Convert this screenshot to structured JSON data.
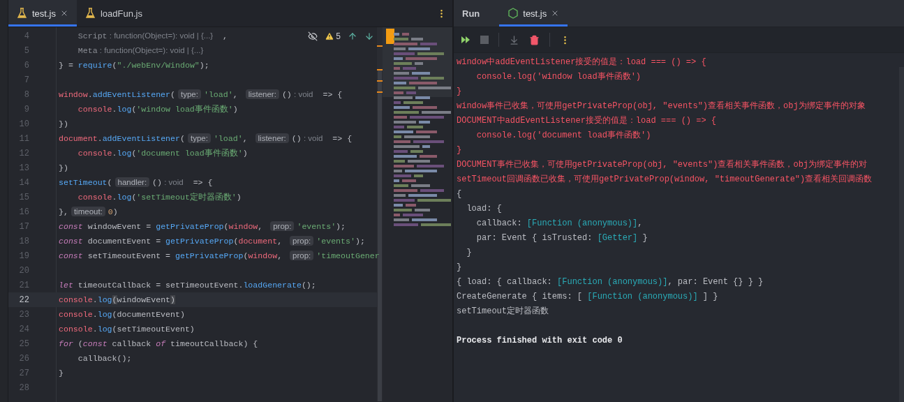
{
  "editor": {
    "tabs": [
      {
        "label": "test.js",
        "selected": true,
        "closable": true
      },
      {
        "label": "loadFun.js",
        "selected": false,
        "closable": false
      }
    ],
    "inspection": {
      "warnings": "5"
    },
    "lines": [
      {
        "number": "4",
        "current": false,
        "tokens": [
          {
            "kind": "dim",
            "text": "    Script"
          },
          {
            "kind": "hint",
            "text": " : function(Object=): void | {...}"
          },
          {
            "kind": "plain",
            "text": "  ,"
          }
        ]
      },
      {
        "number": "5",
        "current": false,
        "tokens": [
          {
            "kind": "dim",
            "text": "    Meta"
          },
          {
            "kind": "hint",
            "text": " : function(Object=): void | {...}"
          }
        ]
      },
      {
        "number": "6",
        "current": false,
        "tokens": [
          {
            "kind": "plain",
            "text": "} = "
          },
          {
            "kind": "fn",
            "text": "require"
          },
          {
            "kind": "plain",
            "text": "("
          },
          {
            "kind": "str",
            "text": "\"./webEnv/Window\""
          },
          {
            "kind": "plain",
            "text": ");"
          }
        ]
      },
      {
        "number": "7",
        "current": false
      },
      {
        "number": "8",
        "current": false,
        "tokens": [
          {
            "kind": "glob",
            "text": "window"
          },
          {
            "kind": "plain",
            "text": "."
          },
          {
            "kind": "fn",
            "text": "addEventListener"
          },
          {
            "kind": "plain",
            "text": "("
          },
          {
            "kind": "chip",
            "text": "type:"
          },
          {
            "kind": "str",
            "text": "'load'"
          },
          {
            "kind": "plain",
            "text": ", "
          },
          {
            "kind": "chip",
            "text": "listener:"
          },
          {
            "kind": "plain",
            "text": "()"
          },
          {
            "kind": "hint",
            "text": " : void"
          },
          {
            "kind": "plain",
            "text": "  => {"
          }
        ]
      },
      {
        "number": "9",
        "current": false,
        "tokens": [
          {
            "kind": "glob",
            "text": "    console"
          },
          {
            "kind": "plain",
            "text": "."
          },
          {
            "kind": "fn",
            "text": "log"
          },
          {
            "kind": "plain",
            "text": "("
          },
          {
            "kind": "str",
            "text": "'window load事件函数'"
          },
          {
            "kind": "plain",
            "text": ")"
          }
        ]
      },
      {
        "number": "10",
        "current": false,
        "tokens": [
          {
            "kind": "plain",
            "text": "})"
          }
        ]
      },
      {
        "number": "11",
        "current": false,
        "tokens": [
          {
            "kind": "glob",
            "text": "document"
          },
          {
            "kind": "plain",
            "text": "."
          },
          {
            "kind": "fn",
            "text": "addEventListener"
          },
          {
            "kind": "plain",
            "text": "("
          },
          {
            "kind": "chip",
            "text": "type:"
          },
          {
            "kind": "str",
            "text": "'load'"
          },
          {
            "kind": "plain",
            "text": ", "
          },
          {
            "kind": "chip",
            "text": "listener:"
          },
          {
            "kind": "plain",
            "text": "()"
          },
          {
            "kind": "hint",
            "text": " : void"
          },
          {
            "kind": "plain",
            "text": "  => {"
          }
        ]
      },
      {
        "number": "12",
        "current": false,
        "tokens": [
          {
            "kind": "glob",
            "text": "    console"
          },
          {
            "kind": "plain",
            "text": "."
          },
          {
            "kind": "fn",
            "text": "log"
          },
          {
            "kind": "plain",
            "text": "("
          },
          {
            "kind": "str",
            "text": "'document load事件函数'"
          },
          {
            "kind": "plain",
            "text": ")"
          }
        ]
      },
      {
        "number": "13",
        "current": false,
        "tokens": [
          {
            "kind": "plain",
            "text": "})"
          }
        ]
      },
      {
        "number": "14",
        "current": false,
        "tokens": [
          {
            "kind": "fn",
            "text": "setTimeout"
          },
          {
            "kind": "plain",
            "text": "("
          },
          {
            "kind": "chip",
            "text": "handler:"
          },
          {
            "kind": "plain",
            "text": "()"
          },
          {
            "kind": "hint",
            "text": " : void"
          },
          {
            "kind": "plain",
            "text": "  => {"
          }
        ]
      },
      {
        "number": "15",
        "current": false,
        "tokens": [
          {
            "kind": "glob",
            "text": "    console"
          },
          {
            "kind": "plain",
            "text": "."
          },
          {
            "kind": "fn",
            "text": "log"
          },
          {
            "kind": "plain",
            "text": "("
          },
          {
            "kind": "str",
            "text": "'setTimeout定时器函数'"
          },
          {
            "kind": "plain",
            "text": ")"
          }
        ]
      },
      {
        "number": "16",
        "current": false,
        "tokens": [
          {
            "kind": "plain",
            "text": "},"
          },
          {
            "kind": "chip",
            "text": "timeout:"
          },
          {
            "kind": "num",
            "text": "0"
          },
          {
            "kind": "plain",
            "text": ")"
          }
        ]
      },
      {
        "number": "17",
        "current": false,
        "tokens": [
          {
            "kind": "kw",
            "text": "const"
          },
          {
            "kind": "plain",
            "text": " windowEvent = "
          },
          {
            "kind": "fn",
            "text": "getPrivateProp"
          },
          {
            "kind": "plain",
            "text": "("
          },
          {
            "kind": "glob",
            "text": "window"
          },
          {
            "kind": "plain",
            "text": ", "
          },
          {
            "kind": "chip",
            "text": "prop:"
          },
          {
            "kind": "str",
            "text": "'events'"
          },
          {
            "kind": "plain",
            "text": ");"
          }
        ]
      },
      {
        "number": "18",
        "current": false,
        "tokens": [
          {
            "kind": "kw",
            "text": "const"
          },
          {
            "kind": "plain",
            "text": " documentEvent = "
          },
          {
            "kind": "fn",
            "text": "getPrivateProp"
          },
          {
            "kind": "plain",
            "text": "("
          },
          {
            "kind": "glob",
            "text": "document"
          },
          {
            "kind": "plain",
            "text": ", "
          },
          {
            "kind": "chip",
            "text": "prop:"
          },
          {
            "kind": "str",
            "text": "'events'"
          },
          {
            "kind": "plain",
            "text": ");"
          }
        ]
      },
      {
        "number": "19",
        "current": false,
        "tokens": [
          {
            "kind": "kw",
            "text": "const"
          },
          {
            "kind": "plain",
            "text": " setTimeoutEvent = "
          },
          {
            "kind": "fn",
            "text": "getPrivateProp"
          },
          {
            "kind": "plain",
            "text": "("
          },
          {
            "kind": "glob",
            "text": "window"
          },
          {
            "kind": "plain",
            "text": ", "
          },
          {
            "kind": "chip",
            "text": "prop:"
          },
          {
            "kind": "str",
            "text": "'timeoutGener"
          }
        ]
      },
      {
        "number": "20",
        "current": false
      },
      {
        "number": "21",
        "current": false,
        "tokens": [
          {
            "kind": "kw",
            "text": "let"
          },
          {
            "kind": "plain",
            "text": " timeoutCallback = setTimeoutEvent."
          },
          {
            "kind": "fn",
            "text": "loadGenerate"
          },
          {
            "kind": "plain",
            "text": "();"
          }
        ]
      },
      {
        "number": "22",
        "current": true,
        "tokens": [
          {
            "kind": "glob",
            "text": "console"
          },
          {
            "kind": "plain",
            "text": "."
          },
          {
            "kind": "fn",
            "text": "log"
          },
          {
            "kind": "bracket",
            "text": "("
          },
          {
            "kind": "plain",
            "text": "windowEvent"
          },
          {
            "kind": "bracket",
            "text": ")"
          }
        ]
      },
      {
        "number": "23",
        "current": false,
        "tokens": [
          {
            "kind": "glob",
            "text": "console"
          },
          {
            "kind": "plain",
            "text": "."
          },
          {
            "kind": "fn",
            "text": "log"
          },
          {
            "kind": "plain",
            "text": "(documentEvent)"
          }
        ]
      },
      {
        "number": "24",
        "current": false,
        "tokens": [
          {
            "kind": "glob",
            "text": "console"
          },
          {
            "kind": "plain",
            "text": "."
          },
          {
            "kind": "fn",
            "text": "log"
          },
          {
            "kind": "plain",
            "text": "(setTimeoutEvent)"
          }
        ]
      },
      {
        "number": "25",
        "current": false,
        "tokens": [
          {
            "kind": "kw",
            "text": "for"
          },
          {
            "kind": "plain",
            "text": " ("
          },
          {
            "kind": "kw",
            "text": "const"
          },
          {
            "kind": "plain",
            "text": " callback "
          },
          {
            "kind": "kw",
            "text": "of"
          },
          {
            "kind": "plain",
            "text": " timeoutCallback) {"
          }
        ]
      },
      {
        "number": "26",
        "current": false,
        "tokens": [
          {
            "kind": "plain",
            "text": "    callback();"
          }
        ]
      },
      {
        "number": "27",
        "current": false,
        "tokens": [
          {
            "kind": "plain",
            "text": "}"
          }
        ]
      },
      {
        "number": "28",
        "current": false
      }
    ]
  },
  "run": {
    "title": "Run",
    "tabs": [
      {
        "label": "test.js",
        "selected": true,
        "closable": true
      }
    ],
    "output": [
      {
        "tokens": [
          {
            "kind": "err",
            "text": "window中addEventListener接受的值是：load === () => {"
          }
        ]
      },
      {
        "tokens": [
          {
            "kind": "err",
            "text": "    console.log('window load事件函数')"
          }
        ]
      },
      {
        "tokens": [
          {
            "kind": "err",
            "text": "}"
          }
        ]
      },
      {
        "tokens": [
          {
            "kind": "err",
            "text": "window事件已收集，可使用getPrivateProp(obj, \"events\")查看相关事件函数，obj为绑定事件的对象"
          }
        ]
      },
      {
        "tokens": [
          {
            "kind": "err",
            "text": "DOCUMENT中addEventListener接受的值是：load === () => {"
          }
        ]
      },
      {
        "tokens": [
          {
            "kind": "err",
            "text": "    console.log('document load事件函数')"
          }
        ]
      },
      {
        "tokens": [
          {
            "kind": "err",
            "text": "}"
          }
        ]
      },
      {
        "tokens": [
          {
            "kind": "err",
            "text": "DOCUMENT事件已收集，可使用getPrivateProp(obj, \"events\")查看相关事件函数，obj为绑定事件的对"
          }
        ]
      },
      {
        "tokens": [
          {
            "kind": "err",
            "text": "setTimeout回调函数已收集，可使用getPrivateProp(window, \"timeoutGenerate\")查看相关回调函数"
          }
        ]
      },
      {
        "tokens": [
          {
            "kind": "out",
            "text": "{"
          }
        ]
      },
      {
        "tokens": [
          {
            "kind": "out",
            "text": "  load: {"
          }
        ]
      },
      {
        "tokens": [
          {
            "kind": "out",
            "text": "    callback: "
          },
          {
            "kind": "link",
            "text": "[Function (anonymous)]"
          },
          {
            "kind": "out",
            "text": ","
          }
        ]
      },
      {
        "tokens": [
          {
            "kind": "out",
            "text": "    par: Event { isTrusted: "
          },
          {
            "kind": "link",
            "text": "[Getter]"
          },
          {
            "kind": "out",
            "text": " }"
          }
        ]
      },
      {
        "tokens": [
          {
            "kind": "out",
            "text": "  }"
          }
        ]
      },
      {
        "tokens": [
          {
            "kind": "out",
            "text": "}"
          }
        ]
      },
      {
        "tokens": [
          {
            "kind": "out",
            "text": "{ load: { callback: "
          },
          {
            "kind": "link",
            "text": "[Function (anonymous)]"
          },
          {
            "kind": "out",
            "text": ", par: Event {} } }"
          }
        ]
      },
      {
        "tokens": [
          {
            "kind": "out",
            "text": "CreateGenerate { items: [ "
          },
          {
            "kind": "link",
            "text": "[Function (anonymous)]"
          },
          {
            "kind": "out",
            "text": " ] }"
          }
        ]
      },
      {
        "tokens": [
          {
            "kind": "out",
            "text": "setTimeout定时器函数"
          }
        ]
      },
      {
        "spaced": true,
        "tokens": [
          {
            "kind": "exit",
            "text": "Process finished with exit code 0"
          }
        ]
      }
    ]
  }
}
